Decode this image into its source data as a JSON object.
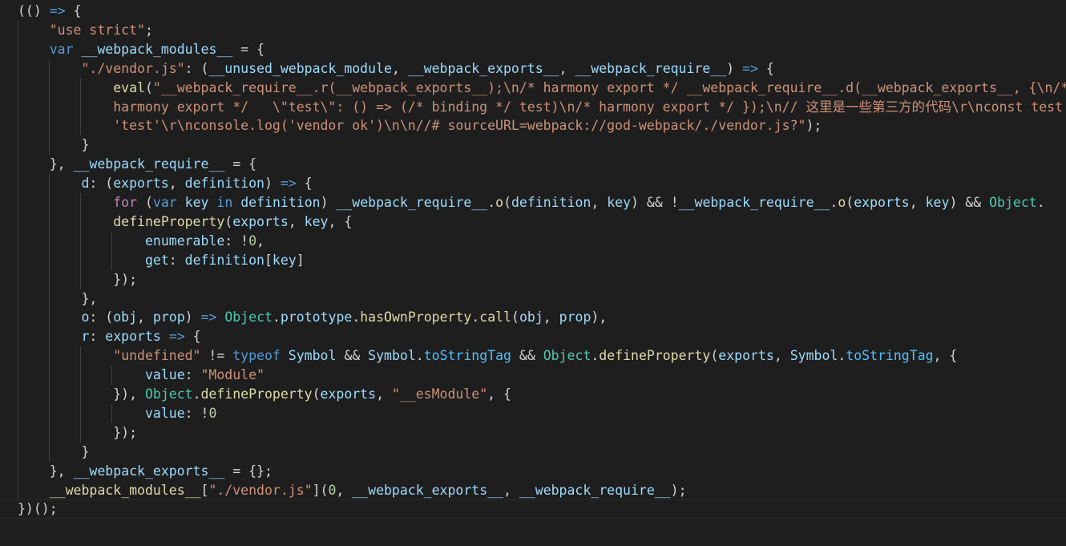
{
  "editor": {
    "language": "javascript",
    "theme": "dark",
    "colors": {
      "background": "#1e1e1e",
      "default": "#d4d4d4",
      "variable": "#9cdcfe",
      "string": "#ce9178",
      "keyword": "#569cd6",
      "control": "#c586c0",
      "function": "#dcdcaa",
      "number": "#b5cea8",
      "type": "#4ec9b0",
      "constant": "#4fc1ff",
      "indent_guide": "#404040"
    },
    "lines": [
      {
        "tokens": [
          [
            "default",
            "(() "
          ],
          [
            "kw",
            "=>"
          ],
          [
            "default",
            " {"
          ]
        ]
      },
      {
        "tokens": [
          [
            "default",
            "    "
          ],
          [
            "str",
            "\"use strict\""
          ],
          [
            "default",
            ";"
          ]
        ]
      },
      {
        "tokens": [
          [
            "default",
            "    "
          ],
          [
            "kw",
            "var"
          ],
          [
            "default",
            " "
          ],
          [
            "var",
            "__webpack_modules__"
          ],
          [
            "default",
            " = {"
          ]
        ]
      },
      {
        "tokens": [
          [
            "default",
            "        "
          ],
          [
            "str",
            "\"./vendor.js\""
          ],
          [
            "default",
            ": ("
          ],
          [
            "var",
            "__unused_webpack_module"
          ],
          [
            "default",
            ", "
          ],
          [
            "var",
            "__webpack_exports__"
          ],
          [
            "default",
            ", "
          ],
          [
            "var",
            "__webpack_require__"
          ],
          [
            "default",
            ") "
          ],
          [
            "kw",
            "=>"
          ],
          [
            "default",
            " {"
          ]
        ]
      },
      {
        "tokens": [
          [
            "default",
            "            "
          ],
          [
            "fn",
            "eval"
          ],
          [
            "default",
            "("
          ],
          [
            "str",
            "\"__webpack_require__.r(__webpack_exports__);\\n/* harmony export */ __webpack_require__.d(__webpack_exports__, {\\n/*"
          ]
        ]
      },
      {
        "tokens": [
          [
            "default",
            "            "
          ],
          [
            "str",
            "harmony export */   \\\"test\\\": () => (/* binding */ test)\\n/* harmony export */ });\\n// 这里是一些第三方的代码\\r\\nconst test ="
          ]
        ]
      },
      {
        "tokens": [
          [
            "default",
            "            "
          ],
          [
            "str",
            "'test'\\r\\nconsole.log('vendor ok')\\n\\n//# sourceURL=webpack://god-webpack/./vendor.js?\""
          ],
          [
            "default",
            ");"
          ]
        ]
      },
      {
        "tokens": [
          [
            "default",
            "        }"
          ]
        ]
      },
      {
        "tokens": [
          [
            "default",
            "    }, "
          ],
          [
            "var",
            "__webpack_require__"
          ],
          [
            "default",
            " = {"
          ]
        ]
      },
      {
        "tokens": [
          [
            "default",
            "        "
          ],
          [
            "var",
            "d"
          ],
          [
            "default",
            ": ("
          ],
          [
            "var",
            "exports"
          ],
          [
            "default",
            ", "
          ],
          [
            "var",
            "definition"
          ],
          [
            "default",
            ") "
          ],
          [
            "kw",
            "=>"
          ],
          [
            "default",
            " {"
          ]
        ]
      },
      {
        "tokens": [
          [
            "default",
            "            "
          ],
          [
            "ctrl",
            "for"
          ],
          [
            "default",
            " ("
          ],
          [
            "kw",
            "var"
          ],
          [
            "default",
            " "
          ],
          [
            "var",
            "key"
          ],
          [
            "default",
            " "
          ],
          [
            "kw",
            "in"
          ],
          [
            "default",
            " "
          ],
          [
            "var",
            "definition"
          ],
          [
            "default",
            ") "
          ],
          [
            "var",
            "__webpack_require__"
          ],
          [
            "default",
            "."
          ],
          [
            "fn",
            "o"
          ],
          [
            "default",
            "("
          ],
          [
            "var",
            "definition"
          ],
          [
            "default",
            ", "
          ],
          [
            "var",
            "key"
          ],
          [
            "default",
            ") && !"
          ],
          [
            "var",
            "__webpack_require__"
          ],
          [
            "default",
            "."
          ],
          [
            "fn",
            "o"
          ],
          [
            "default",
            "("
          ],
          [
            "var",
            "exports"
          ],
          [
            "default",
            ", "
          ],
          [
            "var",
            "key"
          ],
          [
            "default",
            ") && "
          ],
          [
            "type",
            "Object"
          ],
          [
            "default",
            "."
          ]
        ]
      },
      {
        "tokens": [
          [
            "default",
            "            "
          ],
          [
            "fn",
            "defineProperty"
          ],
          [
            "default",
            "("
          ],
          [
            "var",
            "exports"
          ],
          [
            "default",
            ", "
          ],
          [
            "var",
            "key"
          ],
          [
            "default",
            ", {"
          ]
        ]
      },
      {
        "tokens": [
          [
            "default",
            "                "
          ],
          [
            "var",
            "enumerable"
          ],
          [
            "default",
            ": !"
          ],
          [
            "num",
            "0"
          ],
          [
            "default",
            ","
          ]
        ]
      },
      {
        "tokens": [
          [
            "default",
            "                "
          ],
          [
            "var",
            "get"
          ],
          [
            "default",
            ": "
          ],
          [
            "var",
            "definition"
          ],
          [
            "default",
            "["
          ],
          [
            "var",
            "key"
          ],
          [
            "default",
            "]"
          ]
        ]
      },
      {
        "tokens": [
          [
            "default",
            "            });"
          ]
        ]
      },
      {
        "tokens": [
          [
            "default",
            "        },"
          ]
        ]
      },
      {
        "tokens": [
          [
            "default",
            "        "
          ],
          [
            "var",
            "o"
          ],
          [
            "default",
            ": ("
          ],
          [
            "var",
            "obj"
          ],
          [
            "default",
            ", "
          ],
          [
            "var",
            "prop"
          ],
          [
            "default",
            ") "
          ],
          [
            "kw",
            "=>"
          ],
          [
            "default",
            " "
          ],
          [
            "type",
            "Object"
          ],
          [
            "default",
            "."
          ],
          [
            "var",
            "prototype"
          ],
          [
            "default",
            "."
          ],
          [
            "fn",
            "hasOwnProperty"
          ],
          [
            "default",
            "."
          ],
          [
            "fn",
            "call"
          ],
          [
            "default",
            "("
          ],
          [
            "var",
            "obj"
          ],
          [
            "default",
            ", "
          ],
          [
            "var",
            "prop"
          ],
          [
            "default",
            "),"
          ]
        ]
      },
      {
        "tokens": [
          [
            "default",
            "        "
          ],
          [
            "var",
            "r"
          ],
          [
            "default",
            ": "
          ],
          [
            "var",
            "exports"
          ],
          [
            "default",
            " "
          ],
          [
            "kw",
            "=>"
          ],
          [
            "default",
            " {"
          ]
        ]
      },
      {
        "tokens": [
          [
            "default",
            "            "
          ],
          [
            "str",
            "\"undefined\""
          ],
          [
            "default",
            " != "
          ],
          [
            "kw",
            "typeof"
          ],
          [
            "default",
            " "
          ],
          [
            "var",
            "Symbol"
          ],
          [
            "default",
            " && "
          ],
          [
            "var",
            "Symbol"
          ],
          [
            "default",
            "."
          ],
          [
            "const",
            "toStringTag"
          ],
          [
            "default",
            " && "
          ],
          [
            "type",
            "Object"
          ],
          [
            "default",
            "."
          ],
          [
            "fn",
            "defineProperty"
          ],
          [
            "default",
            "("
          ],
          [
            "var",
            "exports"
          ],
          [
            "default",
            ", "
          ],
          [
            "var",
            "Symbol"
          ],
          [
            "default",
            "."
          ],
          [
            "const",
            "toStringTag"
          ],
          [
            "default",
            ", {"
          ]
        ]
      },
      {
        "tokens": [
          [
            "default",
            "                "
          ],
          [
            "var",
            "value"
          ],
          [
            "default",
            ": "
          ],
          [
            "str",
            "\"Module\""
          ]
        ]
      },
      {
        "tokens": [
          [
            "default",
            "            }), "
          ],
          [
            "type",
            "Object"
          ],
          [
            "default",
            "."
          ],
          [
            "fn",
            "defineProperty"
          ],
          [
            "default",
            "("
          ],
          [
            "var",
            "exports"
          ],
          [
            "default",
            ", "
          ],
          [
            "str",
            "\"__esModule\""
          ],
          [
            "default",
            ", {"
          ]
        ]
      },
      {
        "tokens": [
          [
            "default",
            "                "
          ],
          [
            "var",
            "value"
          ],
          [
            "default",
            ": !"
          ],
          [
            "num",
            "0"
          ]
        ]
      },
      {
        "tokens": [
          [
            "default",
            "            });"
          ]
        ]
      },
      {
        "tokens": [
          [
            "default",
            "        }"
          ]
        ]
      },
      {
        "tokens": [
          [
            "default",
            "    }, "
          ],
          [
            "var",
            "__webpack_exports__"
          ],
          [
            "default",
            " = {};"
          ]
        ]
      },
      {
        "tokens": [
          [
            "default",
            "    "
          ],
          [
            "fn",
            "__webpack_modules__"
          ],
          [
            "default",
            "["
          ],
          [
            "str",
            "\"./vendor.js\""
          ],
          [
            "default",
            "]("
          ],
          [
            "num",
            "0"
          ],
          [
            "default",
            ", "
          ],
          [
            "var",
            "__webpack_exports__"
          ],
          [
            "default",
            ", "
          ],
          [
            "var",
            "__webpack_require__"
          ],
          [
            "default",
            ");"
          ]
        ]
      },
      {
        "tokens": [
          [
            "default",
            "})();"
          ]
        ]
      }
    ]
  }
}
